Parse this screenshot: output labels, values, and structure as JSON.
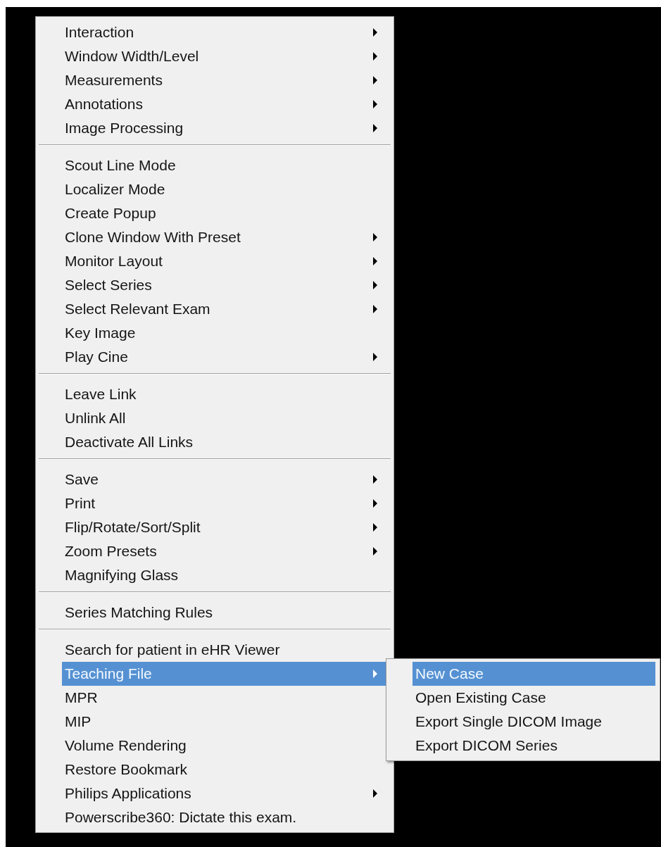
{
  "menu": {
    "groups": [
      {
        "items": [
          {
            "label": "Interaction",
            "has_submenu": true,
            "selected": false
          },
          {
            "label": "Window Width/Level",
            "has_submenu": true,
            "selected": false
          },
          {
            "label": "Measurements",
            "has_submenu": true,
            "selected": false
          },
          {
            "label": "Annotations",
            "has_submenu": true,
            "selected": false
          },
          {
            "label": "Image Processing",
            "has_submenu": true,
            "selected": false
          }
        ]
      },
      {
        "items": [
          {
            "label": "Scout Line Mode",
            "has_submenu": false,
            "selected": false
          },
          {
            "label": "Localizer Mode",
            "has_submenu": false,
            "selected": false
          },
          {
            "label": "Create Popup",
            "has_submenu": false,
            "selected": false
          },
          {
            "label": "Clone Window With Preset",
            "has_submenu": true,
            "selected": false
          },
          {
            "label": "Monitor Layout",
            "has_submenu": true,
            "selected": false
          },
          {
            "label": "Select Series",
            "has_submenu": true,
            "selected": false
          },
          {
            "label": "Select Relevant Exam",
            "has_submenu": true,
            "selected": false
          },
          {
            "label": "Key Image",
            "has_submenu": false,
            "selected": false
          },
          {
            "label": "Play Cine",
            "has_submenu": true,
            "selected": false
          }
        ]
      },
      {
        "items": [
          {
            "label": "Leave Link",
            "has_submenu": false,
            "selected": false
          },
          {
            "label": "Unlink All",
            "has_submenu": false,
            "selected": false
          },
          {
            "label": "Deactivate All Links",
            "has_submenu": false,
            "selected": false
          }
        ]
      },
      {
        "items": [
          {
            "label": "Save",
            "has_submenu": true,
            "selected": false
          },
          {
            "label": "Print",
            "has_submenu": true,
            "selected": false
          },
          {
            "label": "Flip/Rotate/Sort/Split",
            "has_submenu": true,
            "selected": false
          },
          {
            "label": "Zoom Presets",
            "has_submenu": true,
            "selected": false
          },
          {
            "label": "Magnifying Glass",
            "has_submenu": false,
            "selected": false
          }
        ]
      },
      {
        "items": [
          {
            "label": "Series Matching Rules",
            "has_submenu": false,
            "selected": false
          }
        ]
      },
      {
        "items": [
          {
            "label": "Search for patient in eHR Viewer",
            "has_submenu": false,
            "selected": false
          },
          {
            "label": "Teaching File",
            "has_submenu": true,
            "selected": true,
            "submenu": [
              {
                "label": "New Case",
                "selected": true
              },
              {
                "label": "Open Existing Case",
                "selected": false
              },
              {
                "label": "Export Single DICOM Image",
                "selected": false
              },
              {
                "label": "Export DICOM Series",
                "selected": false
              }
            ]
          },
          {
            "label": "MPR",
            "has_submenu": false,
            "selected": false
          },
          {
            "label": "MIP",
            "has_submenu": false,
            "selected": false
          },
          {
            "label": "Volume Rendering",
            "has_submenu": false,
            "selected": false
          },
          {
            "label": "Restore Bookmark",
            "has_submenu": false,
            "selected": false
          },
          {
            "label": "Philips Applications",
            "has_submenu": true,
            "selected": false
          },
          {
            "label": "Powerscribe360: Dictate this exam.",
            "has_submenu": false,
            "selected": false
          }
        ]
      }
    ]
  }
}
